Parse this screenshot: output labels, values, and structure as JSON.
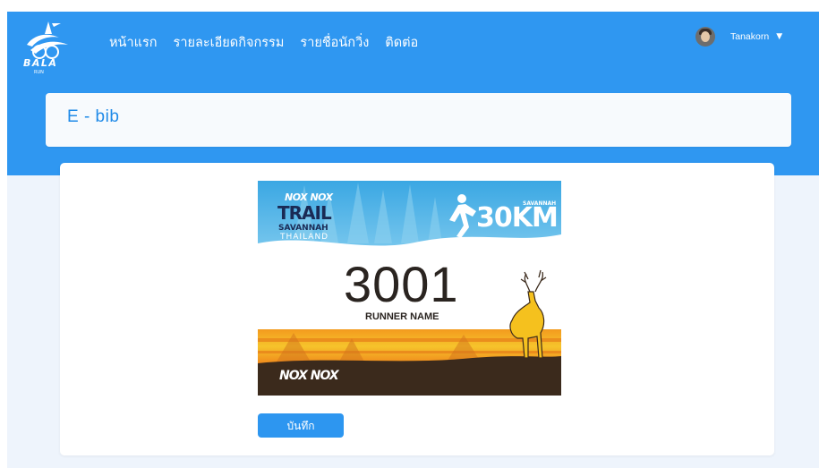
{
  "header": {
    "logo_text": "BALA",
    "logo_subtext": "RUN",
    "nav": [
      {
        "label": "หน้าแรก"
      },
      {
        "label": "รายละเอียดกิจกรรม"
      },
      {
        "label": "รายชื่อนักวิ่ง"
      },
      {
        "label": "ติดต่อ"
      }
    ],
    "user": {
      "name": "Tanakorn",
      "caret": "▼"
    }
  },
  "page": {
    "title": "E - bib"
  },
  "bib": {
    "brand_top": "NOX NOX",
    "event_line1": "TRAIL",
    "event_line2": "SAVANNAH",
    "event_line3": "THAILAND",
    "distance": "30KM",
    "distance_tag": "SAVANNAH",
    "number": "3001",
    "runner_name": "RUNNER NAME",
    "brand_bottom": "NOX NOX",
    "colors": {
      "sky": "#4ab1e8",
      "number": "#2a2420",
      "sunset_orange": "#f08a1c",
      "sunset_yellow": "#f6c22a",
      "ground": "#3b2a1c",
      "deer": "#f5c11e"
    }
  },
  "actions": {
    "save_label": "บันทึก"
  },
  "colors": {
    "primary": "#2f97f1",
    "title": "#1f8ae8",
    "background": "#eef4fc"
  }
}
